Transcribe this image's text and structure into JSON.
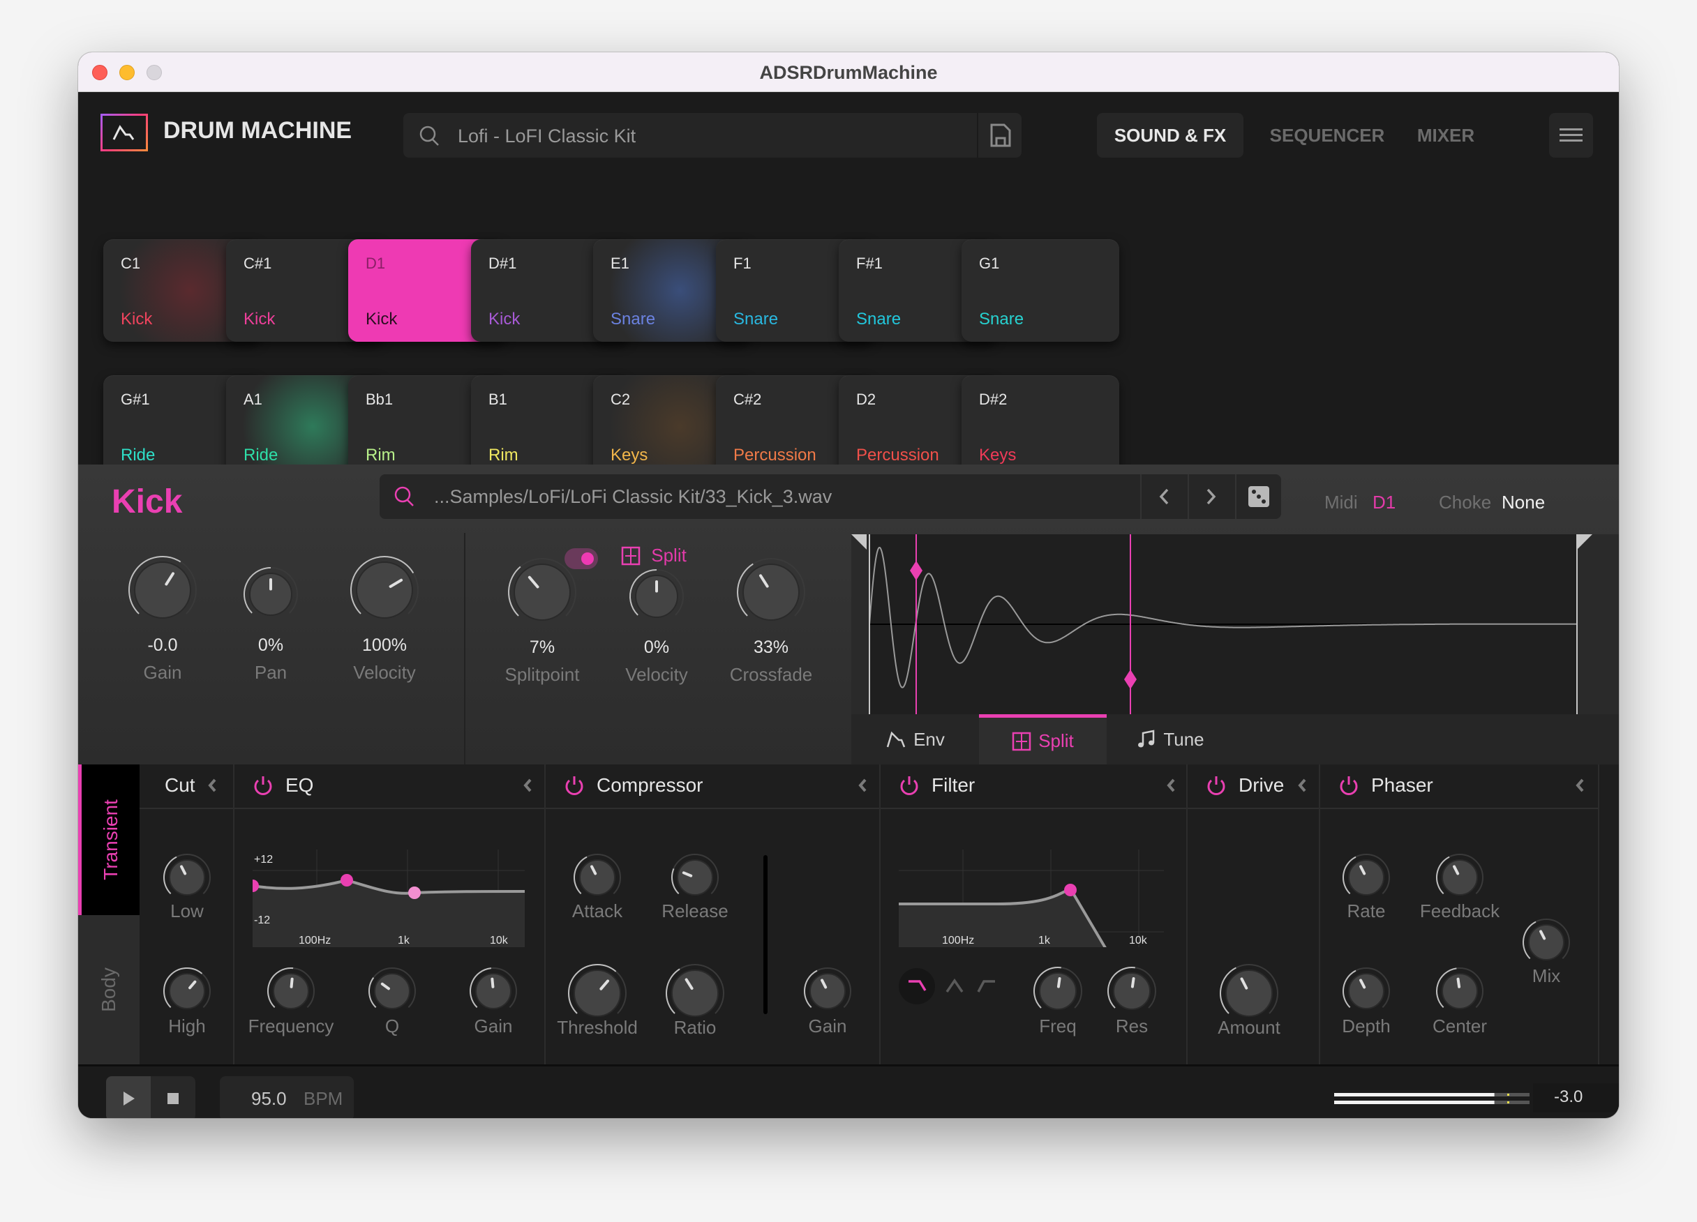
{
  "window": {
    "title": "ADSRDrumMachine"
  },
  "header": {
    "brand": "DRUM MACHINE",
    "kit_search": {
      "value": "Lofi - LoFI Classic Kit",
      "icon": "search-icon"
    },
    "save_icon": "save-icon",
    "tabs": [
      {
        "label": "SOUND & FX",
        "active": true
      },
      {
        "label": "SEQUENCER",
        "active": false
      },
      {
        "label": "MIXER",
        "active": false
      }
    ],
    "menu_icon": "hamburger-menu-icon"
  },
  "pads": [
    {
      "note": "C1",
      "label": "Kick",
      "color": "#f0445e",
      "glow": "#5a2a2e"
    },
    {
      "note": "C#1",
      "label": "Kick",
      "color": "#ee3f9a"
    },
    {
      "note": "D1",
      "label": "Kick",
      "color": "#2a0f20",
      "selected": true
    },
    {
      "note": "D#1",
      "label": "Kick",
      "color": "#a85ad6"
    },
    {
      "note": "E1",
      "label": "Snare",
      "color": "#6b82e0",
      "glow": "#3a4e7a"
    },
    {
      "note": "F1",
      "label": "Snare",
      "color": "#29b8e0"
    },
    {
      "note": "F#1",
      "label": "Snare",
      "color": "#22c7dc"
    },
    {
      "note": "G1",
      "label": "Snare",
      "color": "#27d2d0"
    },
    {
      "note": "G#1",
      "label": "Ride",
      "color": "#2ee0c8"
    },
    {
      "note": "A1",
      "label": "Ride",
      "color": "#2edfa8",
      "glow": "#2e7a5a"
    },
    {
      "note": "Bb1",
      "label": "Rim",
      "color": "#b8f08a"
    },
    {
      "note": "B1",
      "label": "Rim",
      "color": "#f0e860"
    },
    {
      "note": "C2",
      "label": "Keys",
      "color": "#f2b64a",
      "glow": "#4a3a2a"
    },
    {
      "note": "C#2",
      "label": "Percussion",
      "color": "#f07a48"
    },
    {
      "note": "D2",
      "label": "Percussion",
      "color": "#f0504a"
    },
    {
      "note": "D#2",
      "label": "Keys",
      "color": "#f03a58"
    }
  ],
  "sample": {
    "name": "Kick",
    "path": "...Samples/LoFi/LoFi Classic Kit/33_Kick_3.wav",
    "midi_label": "Midi",
    "midi_value": "D1",
    "choke_label": "Choke",
    "choke_value": "None",
    "main_knobs": [
      {
        "label": "Gain",
        "value": "-0.0",
        "position": 0.62
      },
      {
        "label": "Pan",
        "value": "0%",
        "position": 0.5
      },
      {
        "label": "Velocity",
        "value": "100%",
        "position": 0.72
      }
    ],
    "split": {
      "label": "Split",
      "enabled": true,
      "knobs": [
        {
          "label": "Splitpoint",
          "value": "7%",
          "position": 0.35
        },
        {
          "label": "Velocity",
          "value": "0%",
          "position": 0.5
        },
        {
          "label": "Crossfade",
          "value": "33%",
          "position": 0.38
        }
      ]
    },
    "waveform_tabs": [
      {
        "label": "Env",
        "icon": "envelope-icon",
        "active": false
      },
      {
        "label": "Split",
        "icon": "split-icon",
        "active": true
      },
      {
        "label": "Tune",
        "icon": "music-note-icon",
        "active": false
      }
    ]
  },
  "fx": {
    "side_tabs": [
      {
        "label": "Transient",
        "active": true
      },
      {
        "label": "Body",
        "active": false
      }
    ],
    "cut": {
      "title": "Cut",
      "knobs": [
        {
          "label": "Low",
          "position": 0.4
        },
        {
          "label": "High",
          "position": 0.65
        }
      ]
    },
    "eq": {
      "title": "EQ",
      "graph": {
        "ymax": "+12",
        "ymin": "-12",
        "xticks": [
          "100Hz",
          "1k",
          "10k"
        ]
      },
      "knobs": [
        {
          "label": "Frequency",
          "position": 0.52
        },
        {
          "label": "Q",
          "position": 0.3
        },
        {
          "label": "Gain",
          "position": 0.48
        }
      ]
    },
    "compressor": {
      "title": "Compressor",
      "knobs": [
        {
          "label": "Attack",
          "position": 0.4
        },
        {
          "label": "Release",
          "position": 0.25
        },
        {
          "label": "Threshold",
          "position": 0.65
        },
        {
          "label": "Ratio",
          "position": 0.38
        },
        {
          "label": "Gain",
          "position": 0.4
        }
      ]
    },
    "filter": {
      "title": "Filter",
      "graph": {
        "xticks": [
          "100Hz",
          "1k",
          "10k"
        ]
      },
      "types": [
        {
          "name": "lowpass-icon",
          "active": true
        },
        {
          "name": "bandpass-icon",
          "active": false
        },
        {
          "name": "highpass-icon",
          "active": false
        }
      ],
      "knobs": [
        {
          "label": "Freq",
          "position": 0.53
        },
        {
          "label": "Res",
          "position": 0.53
        }
      ]
    },
    "drive": {
      "title": "Drive",
      "knobs": [
        {
          "label": "Amount",
          "position": 0.4
        }
      ]
    },
    "phaser": {
      "title": "Phaser",
      "knobs": [
        {
          "label": "Rate",
          "position": 0.4
        },
        {
          "label": "Feedback",
          "position": 0.4
        },
        {
          "label": "Mix",
          "position": 0.4
        },
        {
          "label": "Depth",
          "position": 0.4
        },
        {
          "label": "Center",
          "position": 0.47
        }
      ]
    }
  },
  "transport": {
    "bpm": "95.0",
    "bpm_unit": "BPM",
    "master_volume": "-3.0",
    "meter_level": 0.82
  },
  "colors": {
    "accent": "#ea40b2",
    "background": "#1b1b1b"
  }
}
